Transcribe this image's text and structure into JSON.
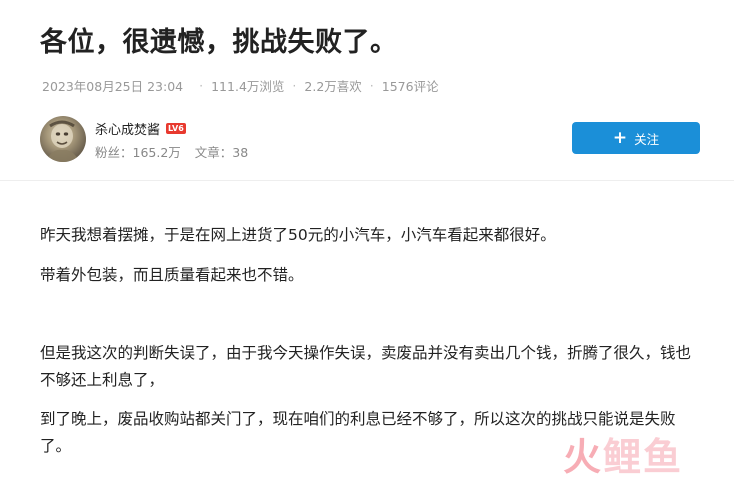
{
  "article": {
    "title": "各位，很遗憾，挑战失败了。",
    "meta": {
      "date": "2023年08月25日 23:04",
      "views": "111.4万浏览",
      "likes": "2.2万喜欢",
      "comments": "1576评论",
      "separator": "·"
    }
  },
  "author": {
    "name": "杀心成焚酱",
    "level_badge": "LV6",
    "fans": "粉丝：165.2万",
    "articles": "文章：38",
    "avatar_icon": "avatar-photo",
    "follow_button": {
      "icon": "plus-icon",
      "plus_glyph": "+",
      "label": "关注",
      "color": "#1b8fd8"
    }
  },
  "body": {
    "paragraphs": [
      "昨天我想着摆摊，于是在网上进货了50元的小汽车，小汽车看起来都很好。",
      "带着外包装，而且质量看起来也不错。",
      "但是我这次的判断失误了，由于我今天操作失误，卖废品并没有卖出几个钱，折腾了很久，钱也不够还上利息了，",
      "到了晚上，废品收购站都关门了，现在咱们的利息已经不够了，所以这次的挑战只能说是失败了。"
    ]
  },
  "watermark": {
    "chars": [
      "火",
      "鲤",
      "鱼"
    ],
    "colors": [
      "#f26b7a",
      "#f7a6b0"
    ]
  }
}
